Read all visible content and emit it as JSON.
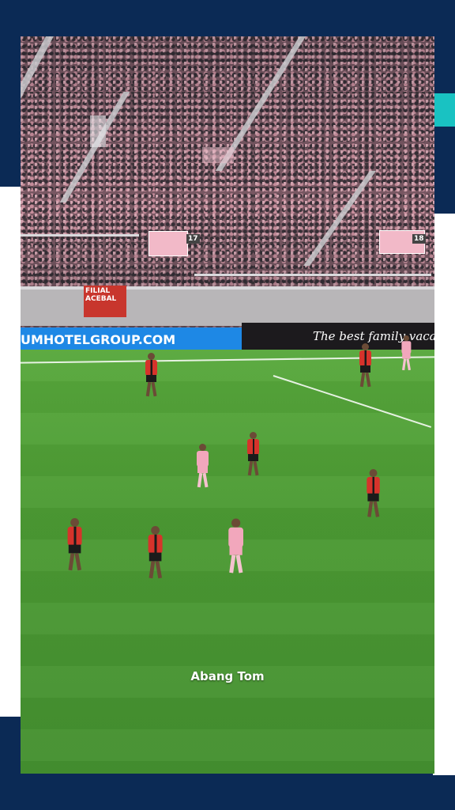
{
  "video": {
    "watermark": "Abang Tom",
    "led_left_text": "UMHOTELGROUP.COM",
    "led_right_text": "The best family vacati",
    "stand_board_left_number": "17",
    "stand_board_right_number": "18",
    "red_banner_text": "FILIAL ACEBAL"
  },
  "colors": {
    "frame": "#0b2a55",
    "accent": "#19c2c2",
    "pitch": "#4b9a33",
    "home_kit": "#f2a7bc",
    "away_kit": "#d6332b"
  }
}
